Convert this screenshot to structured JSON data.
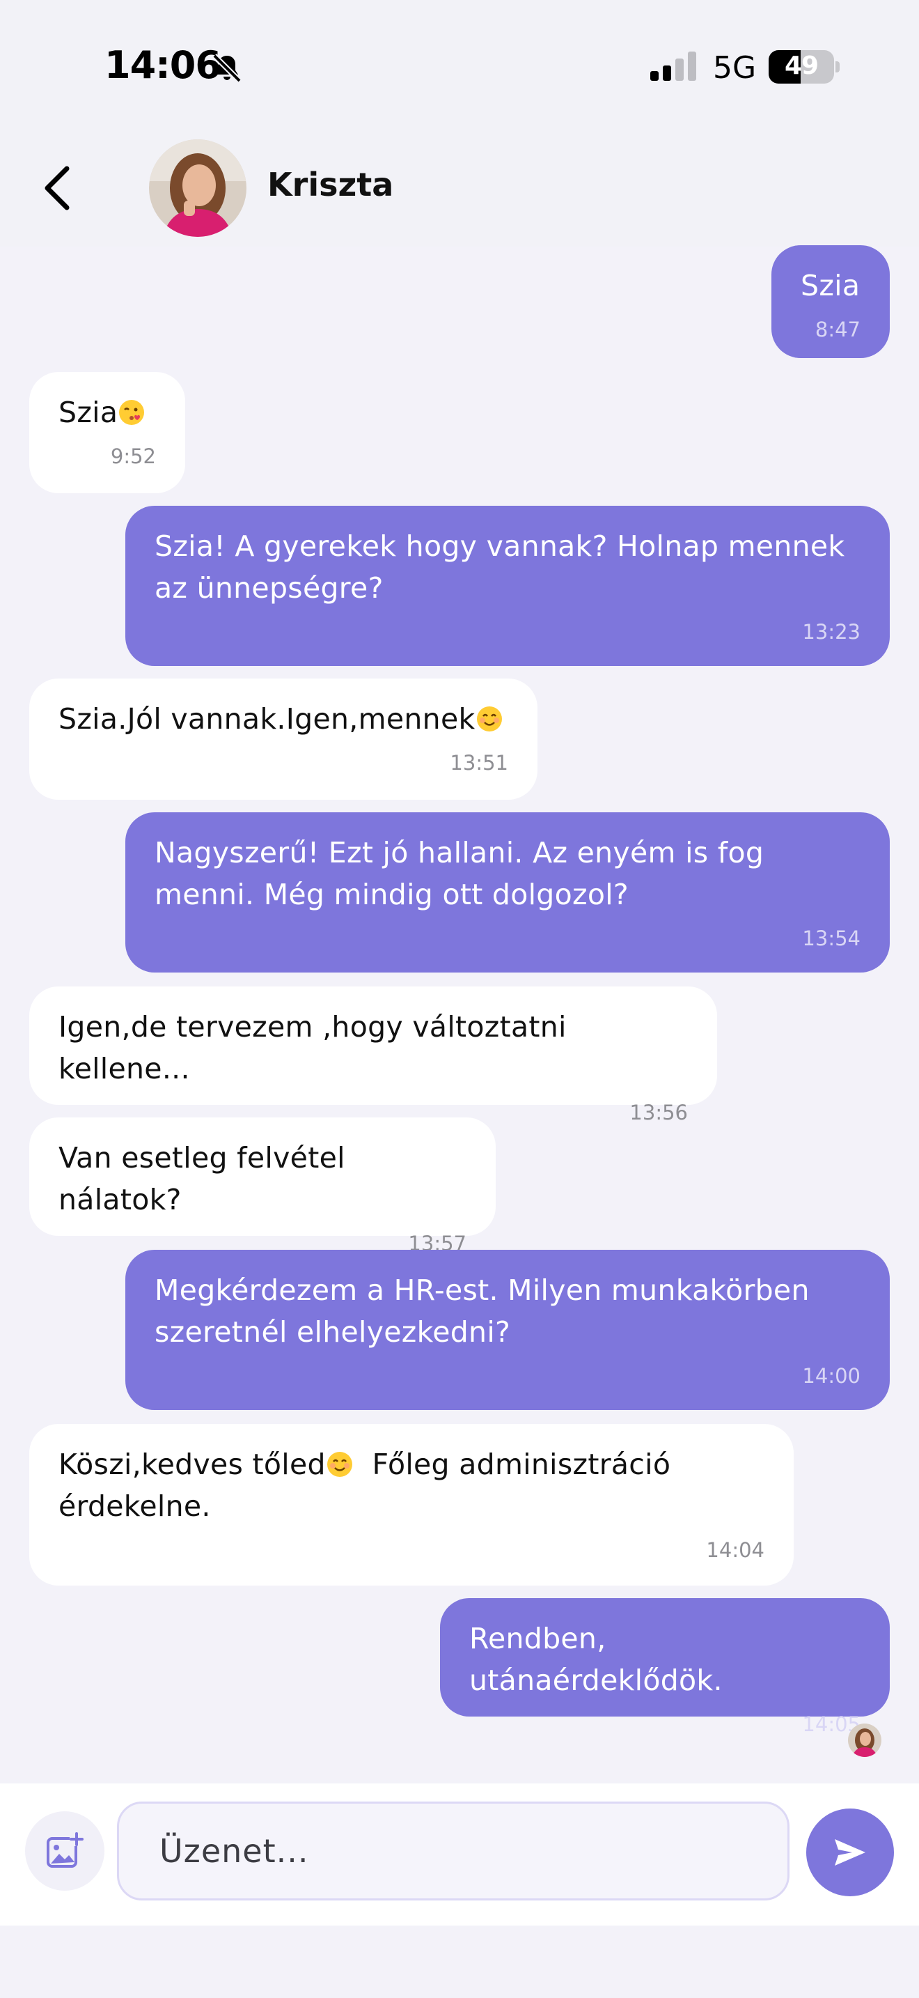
{
  "status_bar": {
    "time": "14:06",
    "network": "5G",
    "battery": "49"
  },
  "header": {
    "contact_name": "Kriszta"
  },
  "messages": [
    {
      "direction": "out",
      "text": "Szia",
      "time": "8:47"
    },
    {
      "direction": "in",
      "text": "Szia",
      "emoji": "kissing-heart-emoji",
      "time": "9:52"
    },
    {
      "direction": "out",
      "text": "Szia! A gyerekek hogy vannak? Holnap mennek az ünnepségre?",
      "time": "13:23"
    },
    {
      "direction": "in",
      "text": "Szia.Jól vannak.Igen,mennek",
      "emoji": "smiling-emoji",
      "time": "13:51"
    },
    {
      "direction": "out",
      "text": "Nagyszerű! Ezt jó hallani. Az enyém is fog menni. Még mindig ott dolgozol?",
      "time": "13:54"
    },
    {
      "direction": "in",
      "text": "Igen,de tervezem ,hogy változtatni kellene...",
      "time": "13:56"
    },
    {
      "direction": "in",
      "text": "Van esetleg felvétel nálatok?",
      "time": "13:57"
    },
    {
      "direction": "out",
      "text": "Megkérdezem a HR-est. Milyen munkakörben szeretnél elhelyezkedni?",
      "time": "14:00"
    },
    {
      "direction": "in",
      "text_before": "Köszi,kedves tőled",
      "emoji": "smiling-emoji",
      "text_after": "  Főleg adminisztráció érdekelne.",
      "time": "14:04"
    },
    {
      "direction": "out",
      "text": "Rendben, utánaérdeklődök.",
      "time": "14:05"
    }
  ],
  "composer": {
    "placeholder": "Üzenet..."
  },
  "icons": {
    "bell": "bell-slash-icon",
    "back": "chevron-left-icon",
    "attach": "image-plus-icon",
    "send": "send-icon"
  },
  "colors": {
    "accent": "#7e76dc",
    "outgoing_bubble": "#7e76dc",
    "incoming_bubble": "#ffffff",
    "background": "#f3f2f9"
  }
}
